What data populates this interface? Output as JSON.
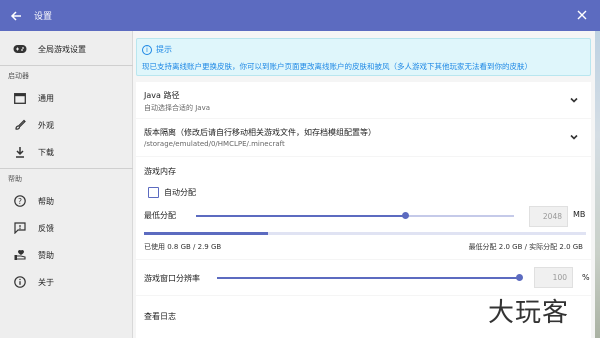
{
  "window": {
    "title": "设置"
  },
  "sidebar": {
    "global": {
      "label": "全局游戏设置",
      "icon": "gamepad-icon"
    },
    "section_launcher": "启动器",
    "launcher_items": [
      {
        "label": "通用",
        "icon": "window-icon"
      },
      {
        "label": "外观",
        "icon": "brush-icon"
      },
      {
        "label": "下载",
        "icon": "download-icon"
      }
    ],
    "section_help": "帮助",
    "help_items": [
      {
        "label": "帮助",
        "icon": "help-icon"
      },
      {
        "label": "反馈",
        "icon": "feedback-icon"
      },
      {
        "label": "赞助",
        "icon": "donate-icon"
      },
      {
        "label": "关于",
        "icon": "info-icon"
      }
    ]
  },
  "notice": {
    "title": "提示",
    "body": "现已支持离线账户更换皮肤，你可以到账户页面更改离线账户的皮肤和披风（多人游戏下其他玩家无法看到你的皮肤）"
  },
  "java": {
    "title": "Java 路径",
    "subtitle": "自动选择合适的 Java"
  },
  "isolation": {
    "title": "版本隔离（修改后请自行移动相关游戏文件，如存档模组配置等）",
    "subtitle": "/storage/emulated/0/HMCLPE/.minecraft"
  },
  "memory": {
    "section_title": "游戏内存",
    "auto_label": "自动分配",
    "auto_checked": false,
    "min_label": "最低分配",
    "min_value": "2048",
    "unit": "MB",
    "min_slider_fraction": 0.66,
    "used_text": "已使用 0.8 GB / 2.9 GB",
    "alloc_text": "最低分配 2.0 GB / 实际分配 2.0 GB",
    "used_fraction": 0.28
  },
  "resolution": {
    "label": "游戏窗口分辨率",
    "value": "100",
    "unit": "%",
    "fraction": 1.0
  },
  "logs": {
    "label": "查看日志"
  },
  "watermark": "大玩客",
  "colors": {
    "primary": "#5c6bc0",
    "notice_bg": "#dff6fb",
    "notice_text": "#1e88e5"
  }
}
